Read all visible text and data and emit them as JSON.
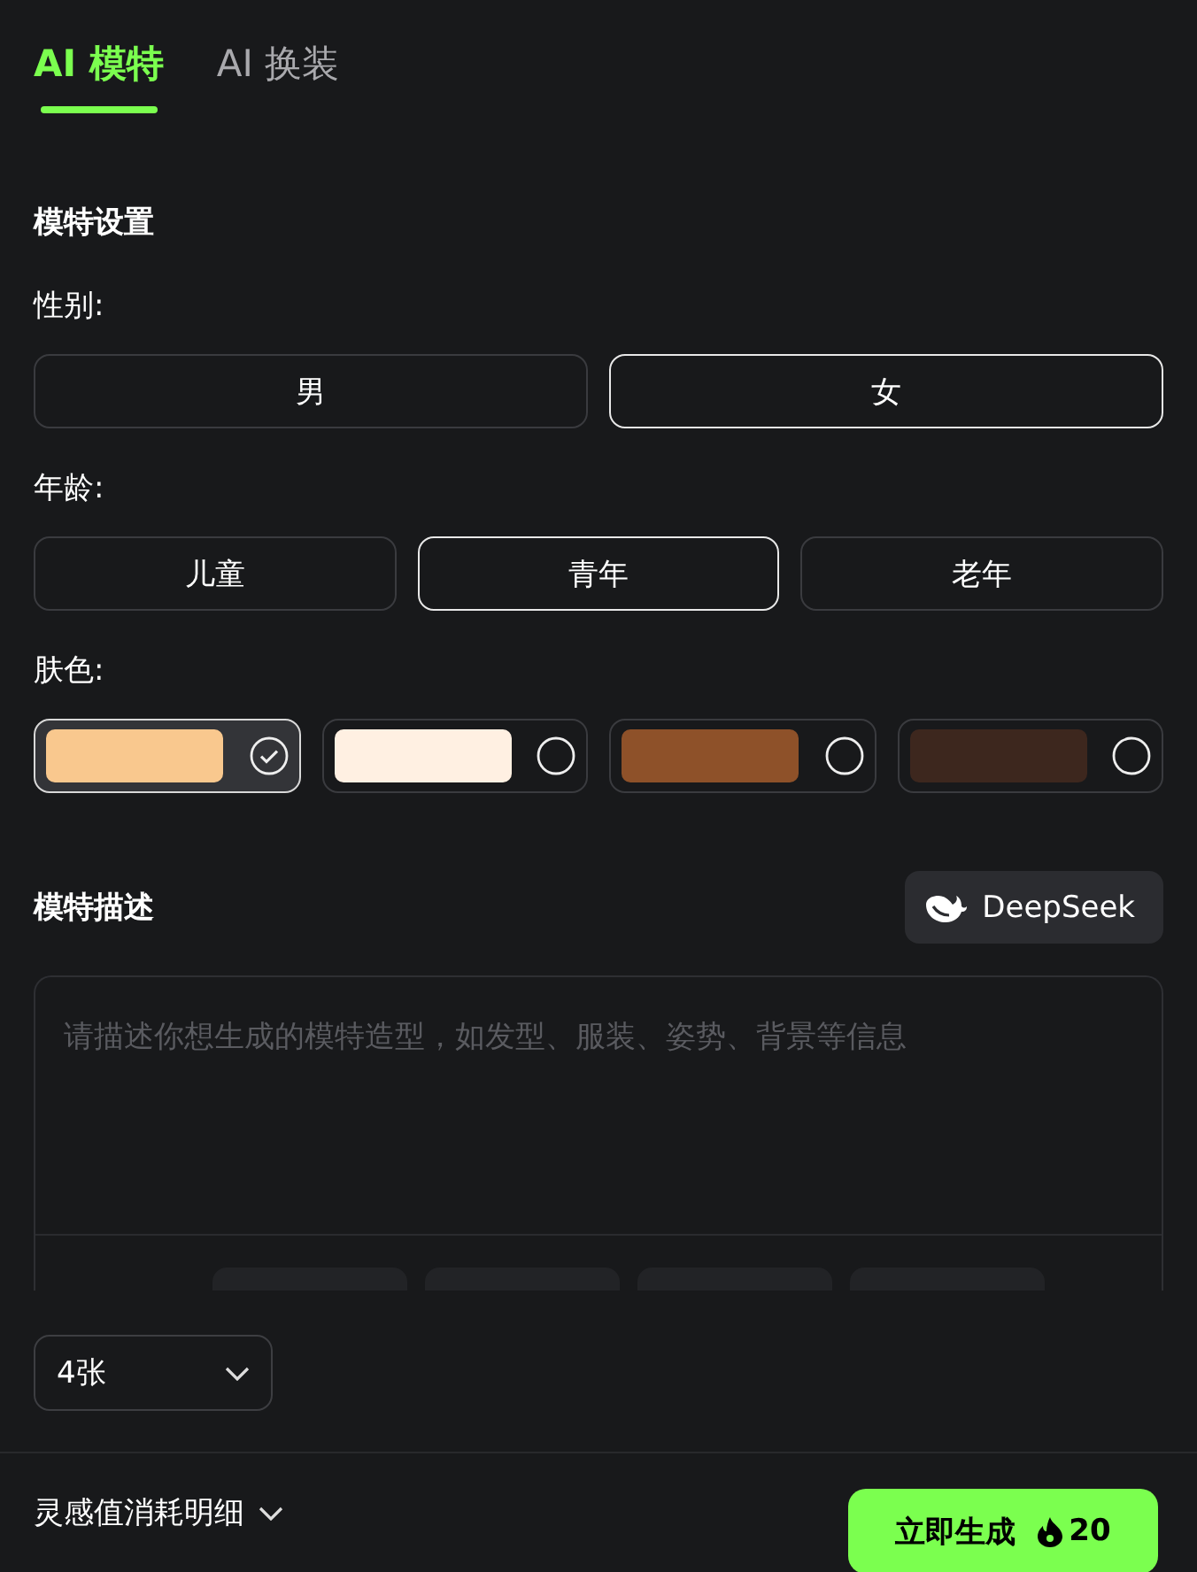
{
  "tabs": [
    {
      "label": "AI 模特",
      "selected": true
    },
    {
      "label": "AI 换装",
      "selected": false
    }
  ],
  "section_title": "模特设置",
  "gender": {
    "label": "性别:",
    "options": [
      {
        "label": "男",
        "selected": false
      },
      {
        "label": "女",
        "selected": true
      }
    ]
  },
  "age": {
    "label": "年龄:",
    "options": [
      {
        "label": "儿童",
        "selected": false
      },
      {
        "label": "青年",
        "selected": true
      },
      {
        "label": "老年",
        "selected": false
      }
    ]
  },
  "skin": {
    "label": "肤色:",
    "options": [
      {
        "color": "#f9c88e",
        "selected": true
      },
      {
        "color": "#fff0e2",
        "selected": false
      },
      {
        "color": "#8e5129",
        "selected": false
      },
      {
        "color": "#3d271e",
        "selected": false
      }
    ]
  },
  "description": {
    "title": "模特描述",
    "deepseek_label": "DeepSeek",
    "placeholder": "请描述你想生成的模特造型，如发型、服装、姿势、背景等信息"
  },
  "count_select": {
    "value": "4张"
  },
  "footer": {
    "cost_label": "灵感值消耗明细",
    "generate_label": "立即生成",
    "cost": "20"
  }
}
